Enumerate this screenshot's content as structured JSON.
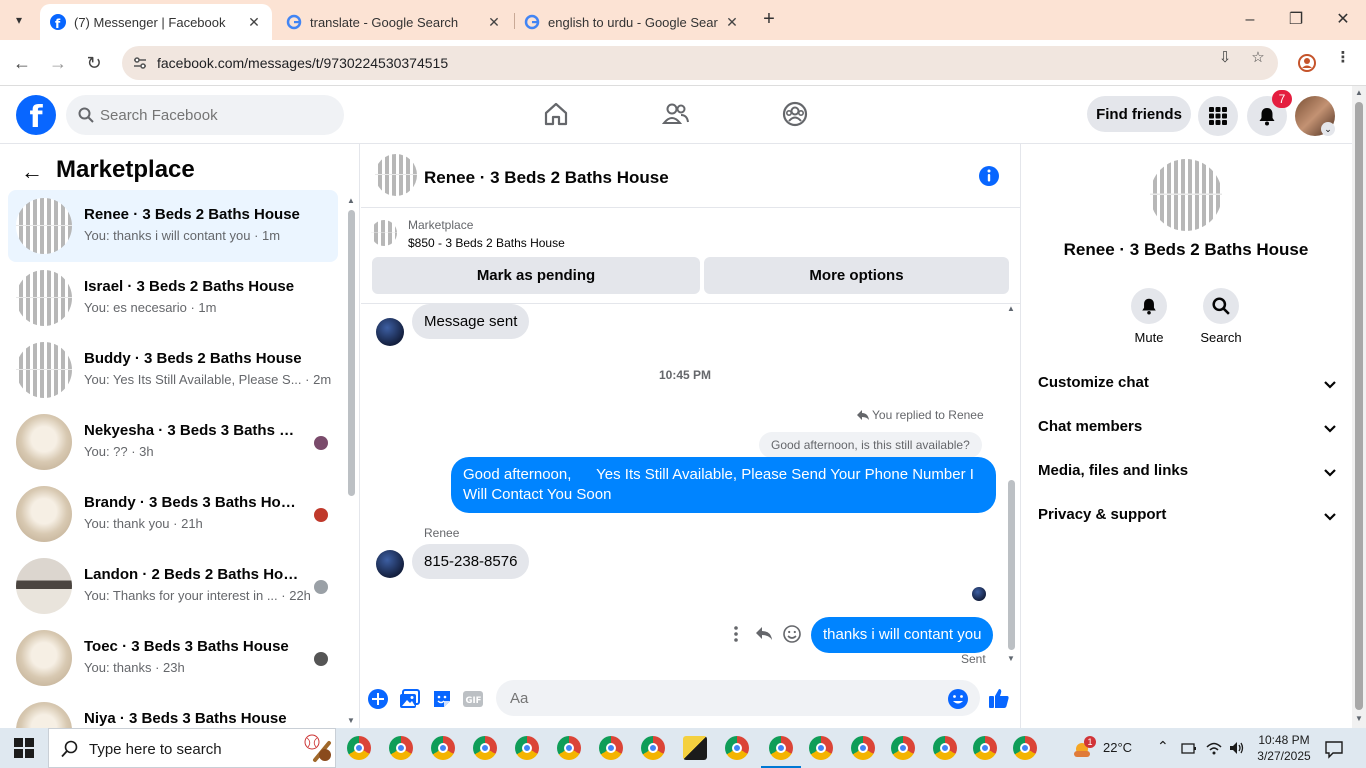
{
  "browser": {
    "tabs": [
      {
        "title": "(7) Messenger | Facebook",
        "active": true
      },
      {
        "title": "translate - Google Search",
        "active": false
      },
      {
        "title": "english to urdu - Google Search",
        "active": false
      }
    ],
    "url": "facebook.com/messages/t/9730224530374515"
  },
  "fb_header": {
    "search_placeholder": "Search Facebook",
    "find_friends": "Find friends",
    "notification_count": "7"
  },
  "left_pane": {
    "title": "Marketplace",
    "conversations": [
      {
        "name": "Renee · 3 Beds 2 Baths House",
        "preview": "You: thanks i will contant you · 1m",
        "active": true,
        "thumb": "porch"
      },
      {
        "name": "Israel · 3 Beds 2 Baths House",
        "preview": "You: es necesario · 1m",
        "active": false,
        "thumb": "porch"
      },
      {
        "name": "Buddy · 3 Beds 2 Baths House",
        "preview": "You: Yes Its Still Available, Please S... · 2m",
        "active": false,
        "thumb": "porch"
      },
      {
        "name": "Nekyesha · 3 Beds 3 Baths Ho...",
        "preview": "You: ?? · 3h",
        "active": false,
        "thumb": "bath"
      },
      {
        "name": "Brandy · 3 Beds 3 Baths House",
        "preview": "You: thank you · 21h",
        "active": false,
        "thumb": "bath"
      },
      {
        "name": "Landon · 2 Beds 2 Baths House",
        "preview": "You: Thanks for your interest in ... · 22h",
        "active": false,
        "thumb": "room"
      },
      {
        "name": "Toec · 3 Beds 3 Baths House",
        "preview": "You: thanks · 23h",
        "active": false,
        "thumb": "bath"
      },
      {
        "name": "Niya · 3 Beds 3 Baths House",
        "preview": "",
        "active": false,
        "thumb": "bath"
      }
    ]
  },
  "chat": {
    "title": "Renee · 3 Beds 2 Baths House",
    "listing_source": "Marketplace",
    "listing_price": "$850 - 3 Beds 2 Baths House",
    "mark_pending": "Mark as pending",
    "more_options": "More options",
    "msg_sent_text": "Message sent",
    "timestamp": "10:45 PM",
    "replied_label": "You replied to Renee",
    "quoted_text": "Good afternoon, is this still available?",
    "reply_line1": "Good afternoon,      Yes Its Still Available, Please Send Your Phone Number I",
    "reply_line2": "Will Contact You Soon",
    "sender_name": "Renee",
    "phone_msg": "815-238-8576",
    "last_msg": "thanks i will contant you",
    "sent_status": "Sent",
    "composer_placeholder": "Aa"
  },
  "right_pane": {
    "name": "Renee · 3 Beds 2 Baths House",
    "mute": "Mute",
    "search": "Search",
    "sections": [
      "Customize chat",
      "Chat members",
      "Media, files and links",
      "Privacy & support"
    ]
  },
  "taskbar": {
    "search_placeholder": "Type here to search",
    "weather_temp": "22°C",
    "weather_badge": "1",
    "time": "10:48 PM",
    "date": "3/27/2025"
  },
  "colors": {
    "fb_blue": "#0866ff",
    "messenger_blue": "#0084ff",
    "active_row": "#ebf5ff"
  }
}
